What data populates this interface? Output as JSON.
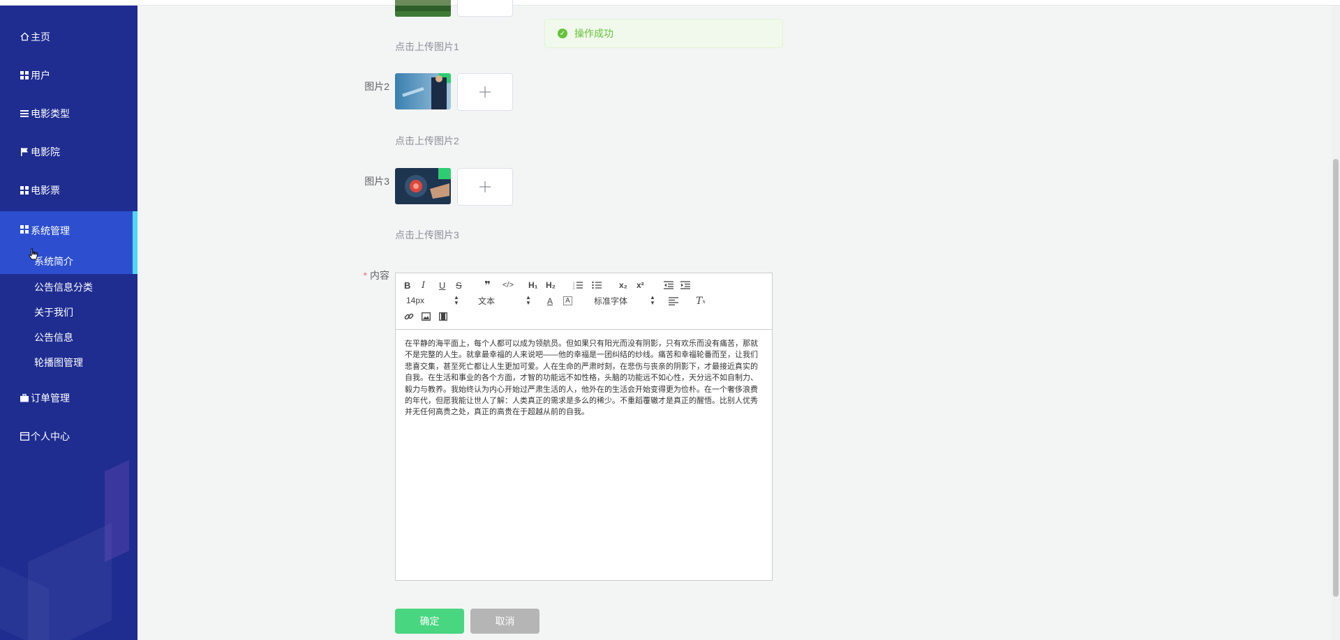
{
  "sidebar": {
    "items": [
      {
        "label": "主页",
        "icon": "home-icon"
      },
      {
        "label": "用户",
        "icon": "grid-icon"
      },
      {
        "label": "电影类型",
        "icon": "list-icon"
      },
      {
        "label": "电影院",
        "icon": "flag-icon"
      },
      {
        "label": "电影票",
        "icon": "grid-icon"
      },
      {
        "label": "系统管理",
        "icon": "grid-icon"
      },
      {
        "label": "订单管理",
        "icon": "briefcase-icon"
      },
      {
        "label": "个人中心",
        "icon": "calendar-icon"
      }
    ],
    "system_sub": [
      {
        "label": "系统简介"
      },
      {
        "label": "公告信息分类"
      },
      {
        "label": "关于我们"
      },
      {
        "label": "公告信息"
      },
      {
        "label": "轮播图管理"
      }
    ]
  },
  "toast": {
    "message": "操作成功",
    "color": "#67c23a"
  },
  "form": {
    "image1": {
      "hint": "点击上传图片1"
    },
    "image2": {
      "label": "图片2",
      "hint": "点击上传图片2"
    },
    "image3": {
      "label": "图片3",
      "hint": "点击上传图片3"
    },
    "content": {
      "required_mark": "*",
      "label": "内容",
      "text": "在平静的海平面上，每个人都可以成为领航员。但如果只有阳光而没有阴影，只有欢乐而没有痛苦，那就不是完整的人生。就拿最幸福的人来说吧——他的幸福是一团纠结的纱线。痛苦和幸福轮番而至，让我们悲喜交集，甚至死亡都让人生更加可爱。人在生命的严肃时刻，在悲伤与丧亲的阴影下，才最接近真实的自我。在生活和事业的各个方面，才智的功能远不如性格，头脑的功能远不如心性，天分远不如自制力、毅力与教养。我始终认为内心开始过严肃生活的人，他外在的生活会开始变得更为俭朴。在一个奢侈浪费的年代，但愿我能让世人了解：人类真正的需求是多么的稀少。不重蹈覆辙才是真正的醒悟。比别人优秀并无任何高贵之处，真正的高贵在于超越从前的自我。"
    }
  },
  "editor": {
    "font_size": "14px",
    "text_type": "文本",
    "font_family": "标准字体"
  },
  "buttons": {
    "ok": "确定",
    "cancel": "取消"
  },
  "colors": {
    "sidebar_bg": "#1f2d91",
    "sidebar_active": "#2d4fcf",
    "accent_bar": "#4fd5f5",
    "ok_button": "#49d680"
  }
}
